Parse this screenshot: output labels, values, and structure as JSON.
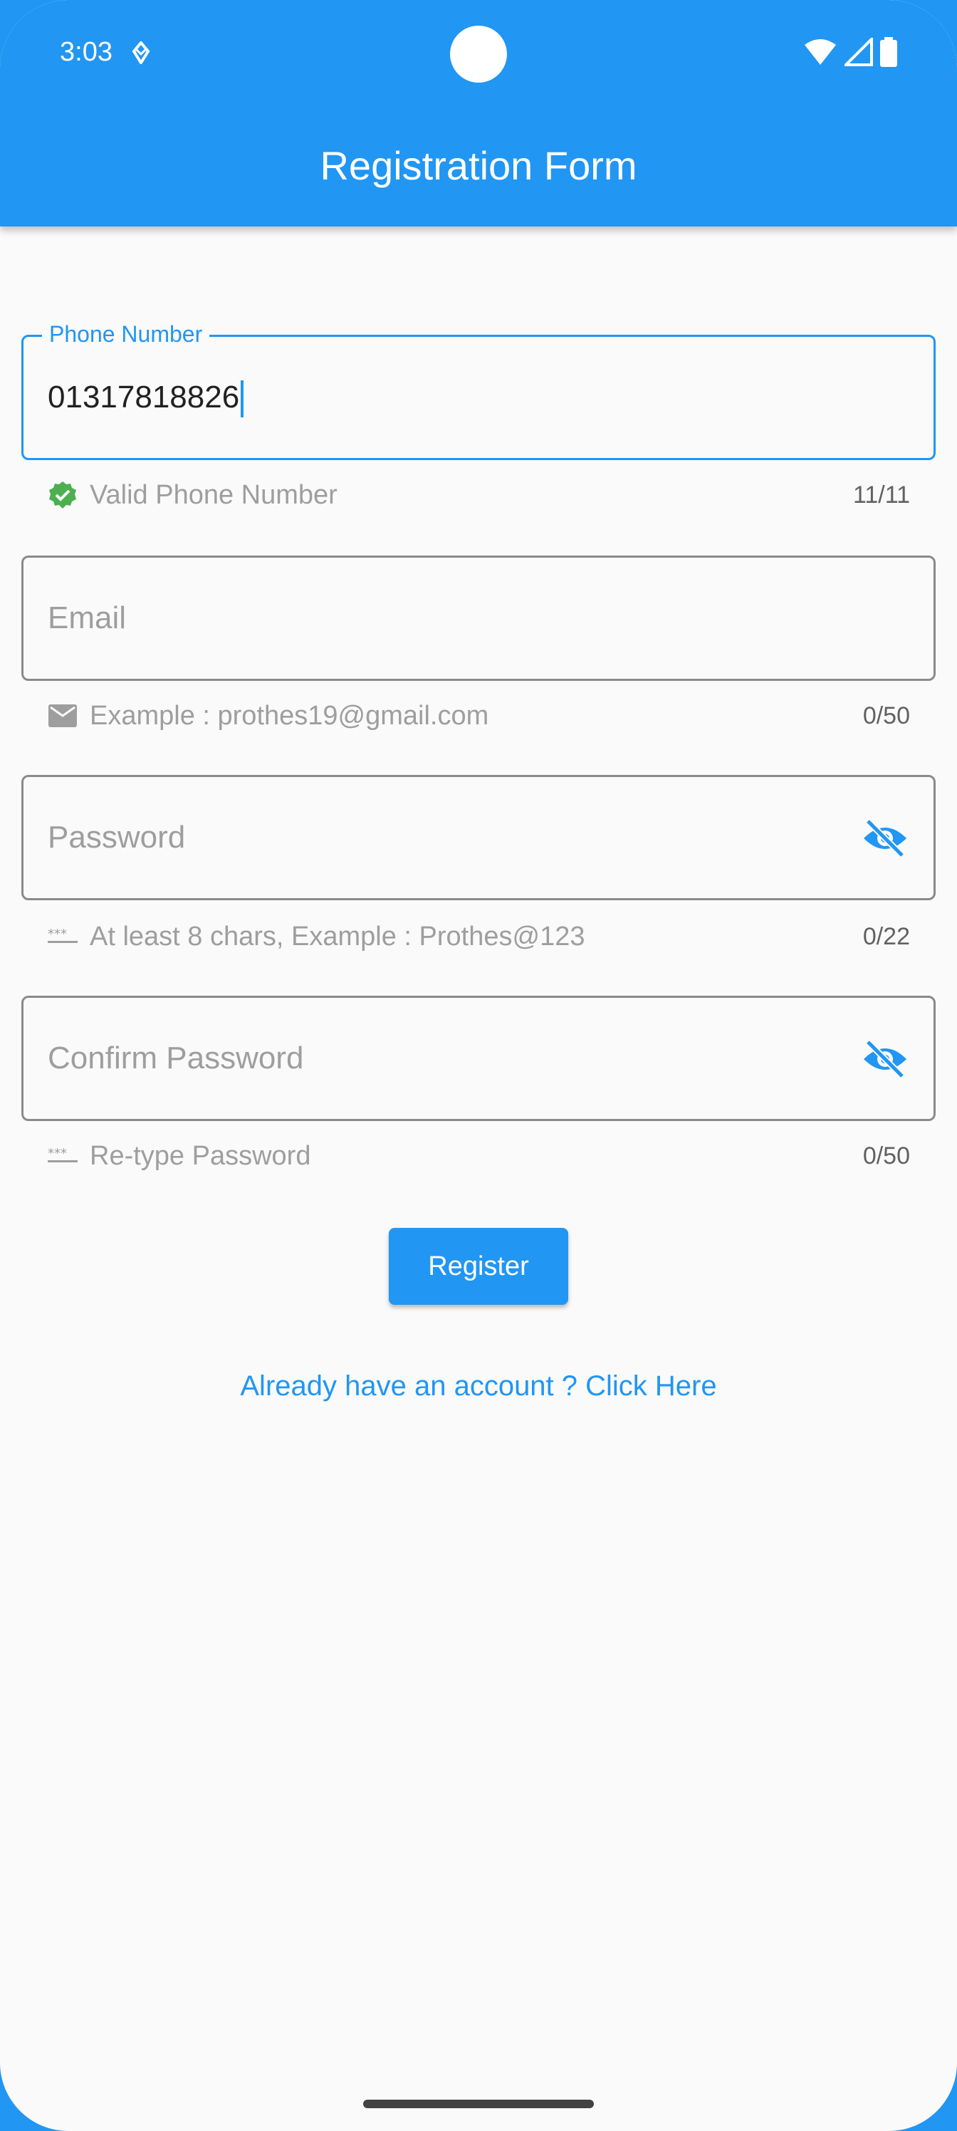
{
  "status_bar": {
    "time": "3:03"
  },
  "app_bar": {
    "title": "Registration Form"
  },
  "form": {
    "phone": {
      "label": "Phone Number",
      "value": "01317818826",
      "helper": "Valid Phone Number",
      "counter": "11/11"
    },
    "email": {
      "placeholder": "Email",
      "helper": "Example : prothes19@gmail.com",
      "counter": "0/50"
    },
    "password": {
      "placeholder": "Password",
      "helper": "At least 8 chars, Example : Prothes@123",
      "counter": "0/22"
    },
    "confirm_password": {
      "placeholder": "Confirm Password",
      "helper": "Re-type Password",
      "counter": "0/50"
    },
    "register_label": "Register",
    "login_link": "Already have an account ? Click Here"
  },
  "colors": {
    "primary": "#2196F3",
    "valid": "#4CAF50",
    "background": "#FAFAFA"
  }
}
